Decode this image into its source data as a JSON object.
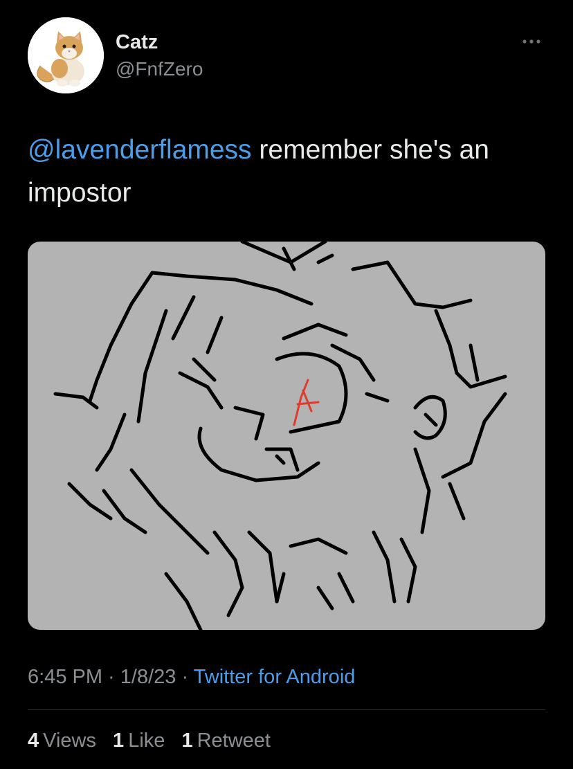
{
  "tweet": {
    "author": {
      "display_name": "Catz",
      "handle": "@FnfZero",
      "avatar_icon": "cat-plush-avatar"
    },
    "text": {
      "mention": "@lavenderflamess",
      "body": " remember she's an impostor"
    },
    "media": {
      "icon": "sketch-drawing-image",
      "background_color": "#b3b3b3"
    },
    "meta": {
      "time": "6:45 PM",
      "separator": " · ",
      "date": "1/8/23",
      "source": "Twitter for Android"
    },
    "stats": {
      "views_count": "4",
      "views_label": "Views",
      "likes_count": "1",
      "likes_label": "Like",
      "retweets_count": "1",
      "retweets_label": "Retweet"
    }
  },
  "colors": {
    "background": "#000000",
    "text": "#e7e9ea",
    "secondary": "#8b8f94",
    "link": "#4a9eeb",
    "divider": "#2f3336"
  }
}
